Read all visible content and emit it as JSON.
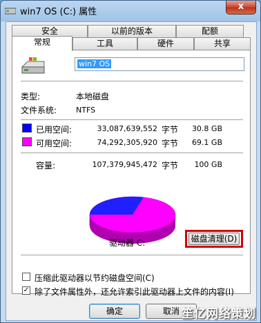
{
  "window": {
    "title": "win7 OS (C:) 属性",
    "close_label": "x"
  },
  "tabs_back": [
    "安全",
    "以前的版本",
    "配额"
  ],
  "tabs_front": [
    "常规",
    "工具",
    "硬件",
    "共享"
  ],
  "general": {
    "name_value": "win7 OS",
    "type_label": "类型:",
    "type_value": "本地磁盘",
    "fs_label": "文件系统:",
    "fs_value": "NTFS",
    "used": {
      "label": "已用空间:",
      "bytes": "33,087,639,552",
      "unit": "字节",
      "size": "30.8 GB",
      "color": "#0000ff"
    },
    "free": {
      "label": "可用空间:",
      "bytes": "74,292,305,920",
      "unit": "字节",
      "size": "69.1 GB",
      "color": "#ff00ff"
    },
    "capacity": {
      "label": "容量:",
      "bytes": "107,379,945,472",
      "unit": "字节",
      "size": "100 GB"
    },
    "drive_label": "驱动器 C:",
    "cleanup_label": "磁盘清理(D)",
    "compress_label": "压缩此驱动器以节约磁盘空间(C)",
    "compress_checked": false,
    "index_label": "除了文件属性外，还允许索引此驱动器上文件的内容(I)",
    "index_checked": true
  },
  "buttons": {
    "ok": "确定",
    "cancel": "取消"
  },
  "watermark": "笙亿网络策划"
}
